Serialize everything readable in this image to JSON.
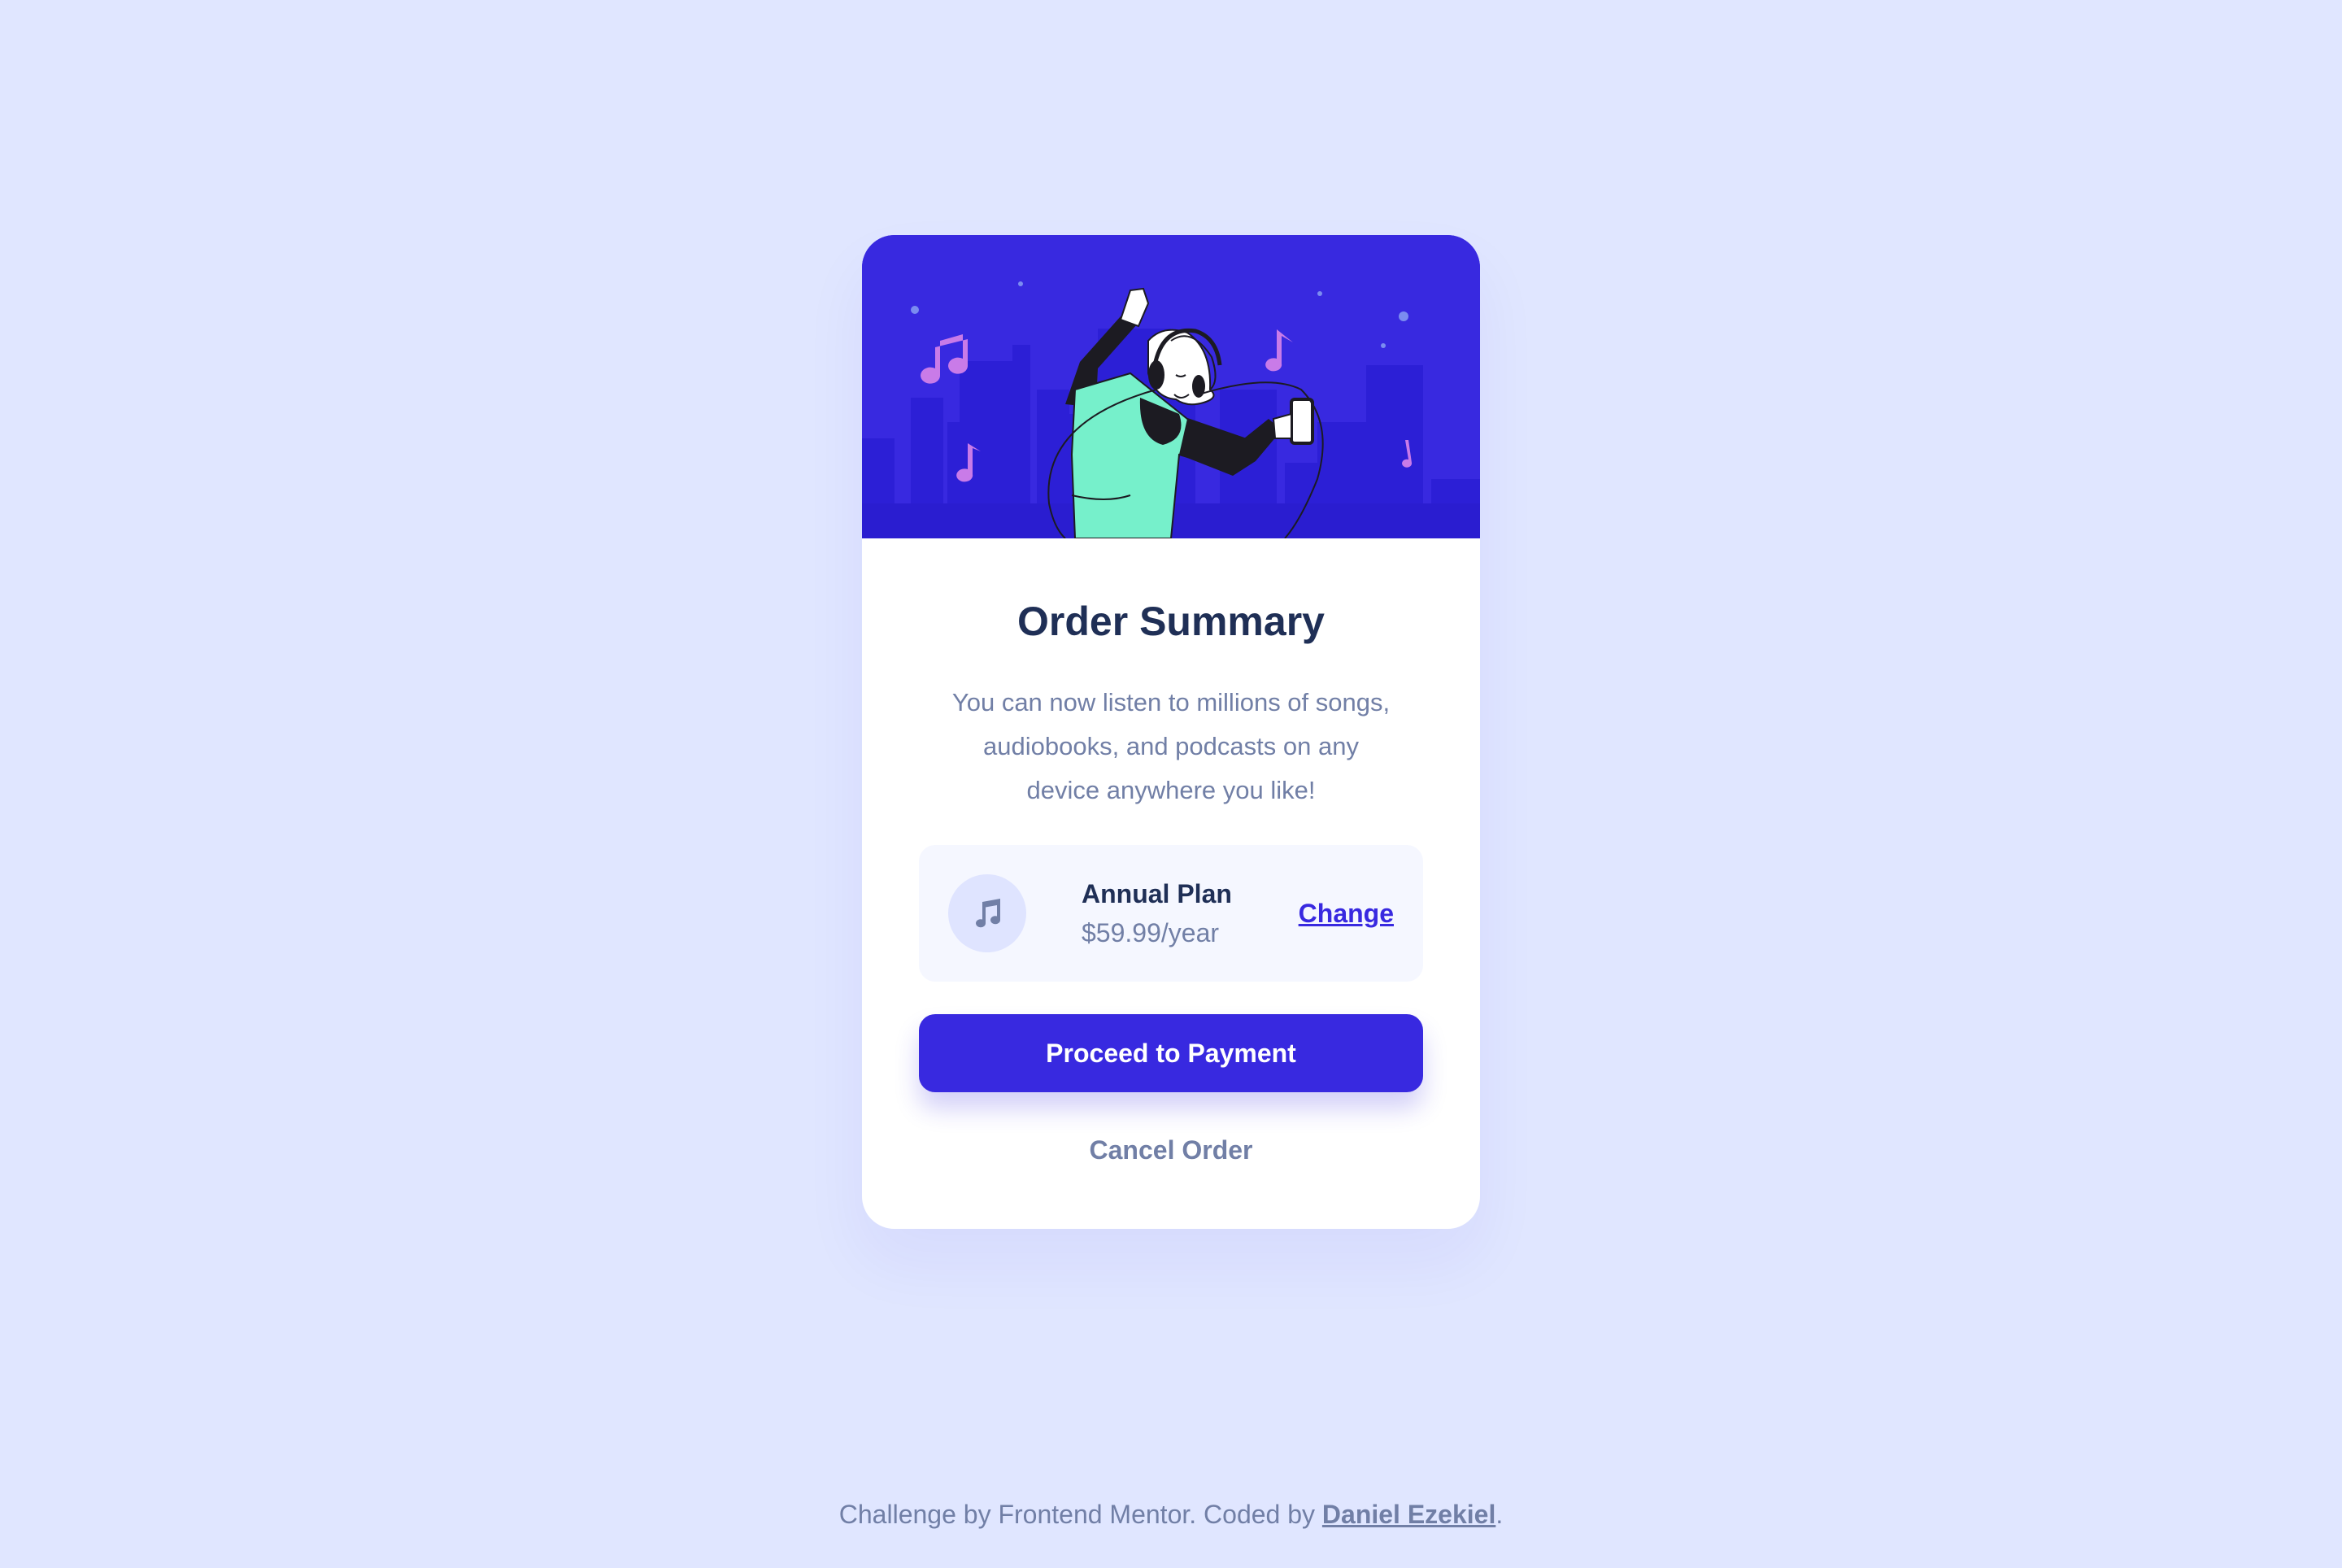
{
  "colors": {
    "page_background": "#e0e6ff",
    "card_background": "#ffffff",
    "accent": "#3829e0",
    "heading": "#1f2f56",
    "muted_text": "#717fa6",
    "plan_background": "#f5f7ff",
    "icon_circle": "#dfe4ff",
    "hero_figure_shirt": "#76f0cb",
    "hero_notes": "#c97be8"
  },
  "hero": {
    "illustration": "person-dancing-with-headphones-city-skyline"
  },
  "card": {
    "title": "Order Summary",
    "description": "You can now listen to millions of songs, audiobooks, and podcasts on any device anywhere you like!",
    "plan": {
      "icon": "music-note-icon",
      "name": "Annual Plan",
      "price": "$59.99/year",
      "change_label": "Change"
    },
    "pay_label": "Proceed to Payment",
    "cancel_label": "Cancel Order"
  },
  "footer": {
    "prefix": "Challenge by Frontend Mentor. Coded by ",
    "author": "Daniel Ezekiel",
    "suffix": "."
  }
}
